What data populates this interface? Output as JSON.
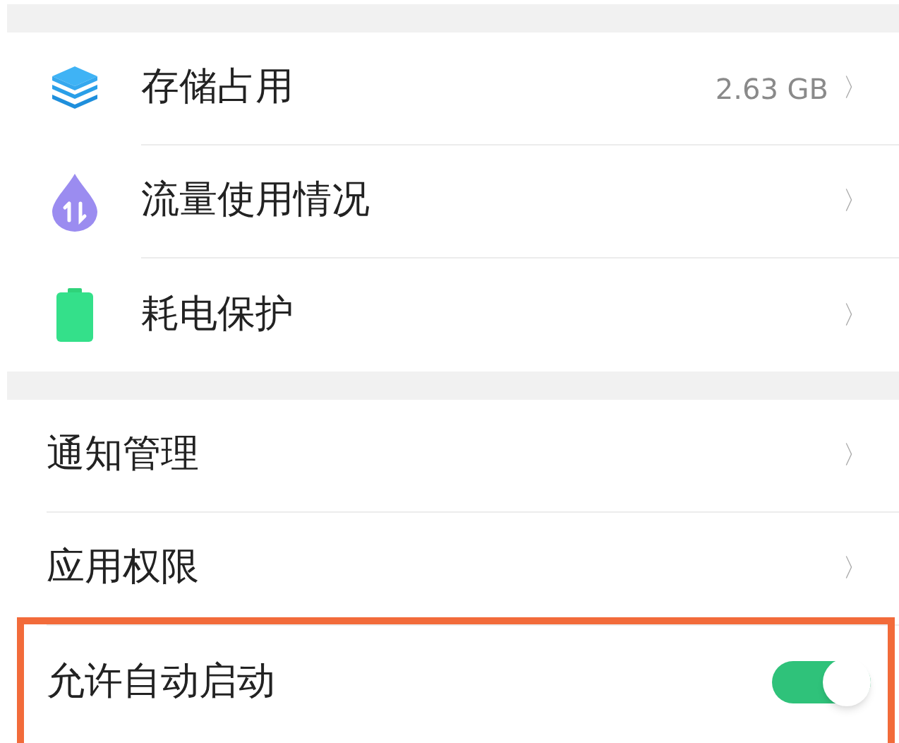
{
  "sections": [
    {
      "items": [
        {
          "kind": "link",
          "label": "存储占用",
          "value": "2.63 GB",
          "chevron": "〉"
        },
        {
          "kind": "link",
          "label": "流量使用情况",
          "chevron": "〉"
        },
        {
          "kind": "link",
          "label": "耗电保护",
          "chevron": "〉"
        }
      ]
    },
    {
      "items": [
        {
          "kind": "link",
          "label": "通知管理",
          "chevron": "〉"
        },
        {
          "kind": "link",
          "label": "应用权限",
          "chevron": "〉"
        },
        {
          "kind": "toggle",
          "label": "允许自动启动",
          "on": true,
          "highlighted": true
        }
      ]
    }
  ]
}
